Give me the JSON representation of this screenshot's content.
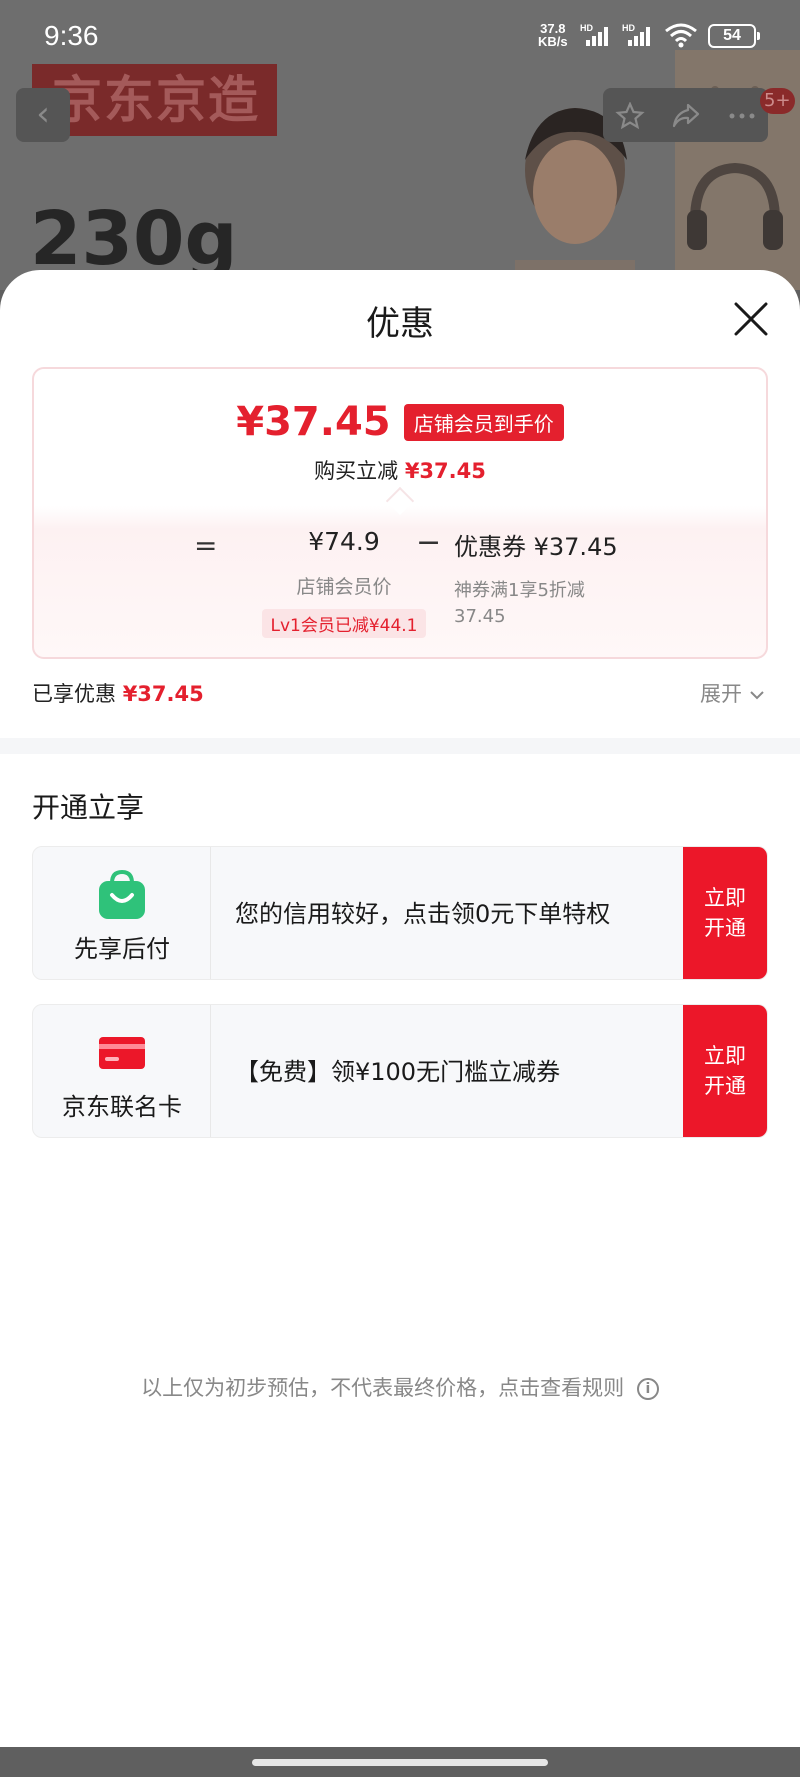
{
  "status_bar": {
    "time": "9:36",
    "net_speed_value": "37.8",
    "net_speed_unit": "KB/s",
    "signal_label_1": "HD",
    "signal_label_2": "HD",
    "battery": "54"
  },
  "background_page": {
    "brand": "京东京造",
    "weight": "230g",
    "badge": "5+"
  },
  "sheet": {
    "title": "优惠"
  },
  "price_card": {
    "final_price": "¥37.45",
    "price_tag": "店铺会员到手价",
    "reduce_label": "购买立减",
    "reduce_value": "¥37.45",
    "equals": "=",
    "member_price": "¥74.9",
    "member_price_label": "店铺会员价",
    "member_discount": "Lv1会员已减¥44.1",
    "minus": "−",
    "coupon_label": "优惠券 ¥37.45",
    "coupon_desc": "神券满1享5折减37.45"
  },
  "summary": {
    "enjoyed_label": "已享优惠",
    "enjoyed_value": "¥37.45",
    "expand_label": "展开"
  },
  "open_section": {
    "title": "开通立享",
    "offers": [
      {
        "icon": "shopping-bag-icon",
        "label": "先享后付",
        "desc": "您的信用较好，点击领0元下单特权",
        "cta": "立即\n开通"
      },
      {
        "icon": "credit-card-icon",
        "label": "京东联名卡",
        "desc": "【免费】领¥100无门槛立减券",
        "cta": "立即\n开通"
      }
    ]
  },
  "disclaimer": {
    "text": "以上仅为初步预估，不代表最终价格，点击查看规则",
    "info_icon": "i"
  },
  "colors": {
    "accent_red": "#e4202e",
    "cta_red": "#ec1729",
    "green": "#2fc27a"
  }
}
